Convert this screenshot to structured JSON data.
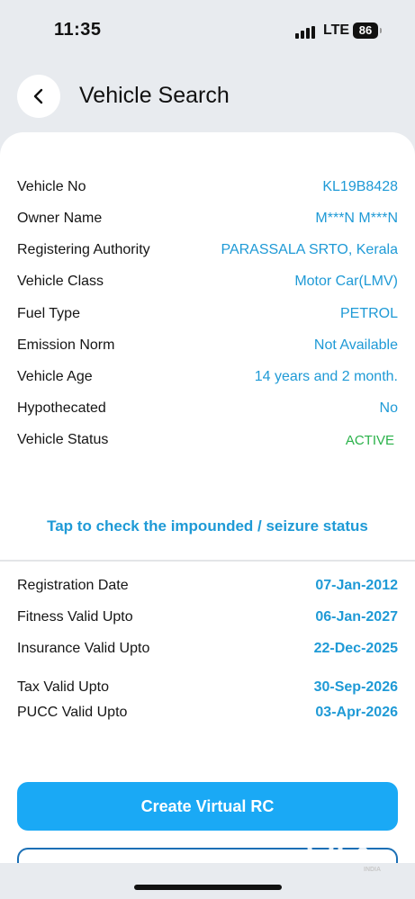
{
  "status_bar": {
    "time": "11:35",
    "network": "LTE",
    "battery": "86"
  },
  "header": {
    "title": "Vehicle Search"
  },
  "details": [
    {
      "label": "Vehicle No",
      "value": "KL19B8428"
    },
    {
      "label": "Owner Name",
      "value": "M***N M***N"
    },
    {
      "label": "Registering Authority",
      "value": "PARASSALA SRTO, Kerala"
    },
    {
      "label": "Vehicle Class",
      "value": "Motor Car(LMV)"
    },
    {
      "label": "Fuel Type",
      "value": "PETROL"
    },
    {
      "label": "Emission Norm",
      "value": "Not Available"
    },
    {
      "label": "Vehicle Age",
      "value": "14 years and 2 month."
    },
    {
      "label": "Hypothecated",
      "value": "No"
    },
    {
      "label": "Vehicle Status",
      "value": "ACTIVE"
    }
  ],
  "seizure_link": "Tap to check the impounded / seizure status",
  "validity": [
    {
      "label": "Registration Date",
      "value": "07-Jan-2012"
    },
    {
      "label": "Fitness Valid Upto",
      "value": "06-Jan-2027"
    },
    {
      "label": "Insurance Valid Upto",
      "value": "22-Dec-2025"
    },
    {
      "label": "Tax Valid Upto",
      "value": "30-Sep-2026"
    },
    {
      "label": "PUCC Valid Upto",
      "value": "03-Apr-2026"
    }
  ],
  "actions": {
    "primary": "Create Virtual RC"
  },
  "watermark": {
    "brand": "OLX",
    "sub": "INDIA"
  },
  "colors": {
    "accent": "#1f9ad6",
    "active": "#2ab24a",
    "button": "#1aa9f5"
  }
}
